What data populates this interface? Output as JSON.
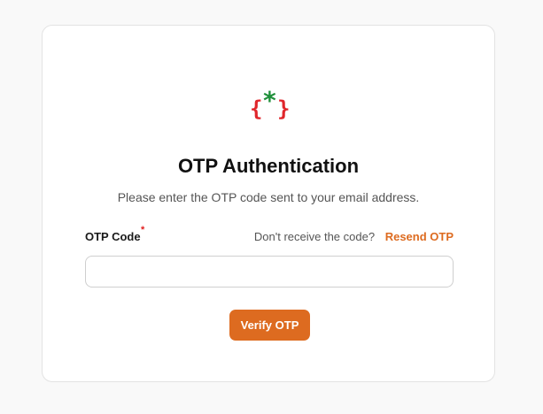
{
  "card": {
    "title": "OTP Authentication",
    "subtitle": "Please enter the OTP code sent to your email address."
  },
  "logo": {
    "icon": "curly-braces-asterisk-logo",
    "left_brace": "{",
    "asterisk": "*",
    "right_brace": "}",
    "brace_color": "#e0262b",
    "asterisk_color": "#1f8f3a"
  },
  "form": {
    "otp_label": "OTP Code",
    "required_mark": "*",
    "otp_value": "",
    "otp_placeholder": "",
    "resend_question": "Don't receive the code?",
    "resend_link": "Resend OTP",
    "verify_button": "Verify OTP"
  },
  "colors": {
    "accent": "#dd6b20",
    "background": "#f9f9f9",
    "card": "#ffffff",
    "required": "#e11d1d"
  }
}
